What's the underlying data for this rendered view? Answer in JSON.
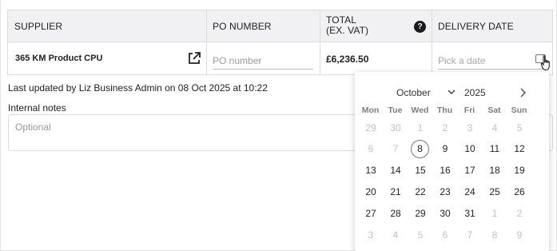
{
  "table": {
    "headers": {
      "supplier": "SUPPLIER",
      "po_number": "PO NUMBER",
      "total_line1": "TOTAL",
      "total_line2": "(EX. VAT)",
      "delivery_date": "DELIVERY DATE"
    },
    "help_icon": "question-icon",
    "help_glyph": "?",
    "row": {
      "supplier_name": "365 KM Product CPU",
      "external_icon": "external-link-icon",
      "po_placeholder": "PO number",
      "total": "£6,236.50",
      "date_placeholder": "Pick a date",
      "calendar_icon": "calendar-icon"
    }
  },
  "updated_text": "Last updated by Liz Business Admin on 08 Oct 2025 at 10:22",
  "notes": {
    "label": "Internal notes",
    "placeholder": "Optional"
  },
  "datepicker": {
    "month": "October",
    "year": "2025",
    "month_chevron_icon": "chevron-down-icon",
    "next_icon": "chevron-right-icon",
    "weekdays": [
      "Mon",
      "Tue",
      "Wed",
      "Thu",
      "Fri",
      "Sat",
      "Sun"
    ],
    "weeks": [
      [
        "29",
        "30",
        "1",
        "2",
        "3",
        "4",
        "5"
      ],
      [
        "6",
        "7",
        "8",
        "9",
        "10",
        "11",
        "12"
      ],
      [
        "13",
        "14",
        "15",
        "16",
        "17",
        "18",
        "19"
      ],
      [
        "20",
        "21",
        "22",
        "23",
        "24",
        "25",
        "26"
      ],
      [
        "27",
        "28",
        "29",
        "30",
        "31",
        "1",
        "2"
      ],
      [
        "3",
        "4",
        "5",
        "6",
        "7",
        "8",
        "9"
      ]
    ],
    "out_of_month": [
      [
        true,
        true,
        true,
        true,
        true,
        true,
        true
      ],
      [
        true,
        true,
        false,
        false,
        false,
        false,
        false
      ],
      [
        false,
        false,
        false,
        false,
        false,
        false,
        false
      ],
      [
        false,
        false,
        false,
        false,
        false,
        false,
        false
      ],
      [
        false,
        false,
        false,
        false,
        false,
        true,
        true
      ],
      [
        true,
        true,
        true,
        true,
        true,
        true,
        true
      ]
    ],
    "today": "8"
  },
  "colors": {
    "header_bg": "#f1f1f3",
    "border": "#dcdcdc",
    "muted_day": "#c2c2c2",
    "weekday_label": "#7d7d7d"
  }
}
